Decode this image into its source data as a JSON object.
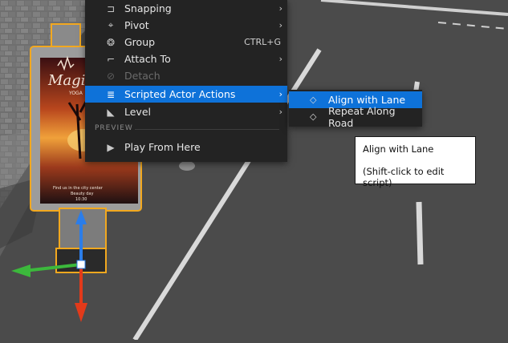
{
  "context_menu": {
    "items": [
      {
        "label": "Snapping",
        "icon": "snap-icon",
        "glyph": "⊐",
        "has_submenu": true
      },
      {
        "label": "Pivot",
        "icon": "pivot-icon",
        "glyph": "⌖",
        "has_submenu": true
      },
      {
        "label": "Group",
        "icon": "group-icon",
        "glyph": "❂",
        "shortcut": "CTRL+G"
      },
      {
        "label": "Attach To",
        "icon": "attach-icon",
        "glyph": "⌐",
        "has_submenu": true
      },
      {
        "label": "Detach",
        "icon": "detach-icon",
        "glyph": "⊘",
        "disabled": true
      },
      {
        "label": "Scripted Actor Actions",
        "icon": "script-icon",
        "glyph": "≣",
        "has_submenu": true,
        "active": true
      },
      {
        "label": "Level",
        "icon": "level-icon",
        "glyph": "◣",
        "has_submenu": true
      }
    ],
    "section_header": "PREVIEW",
    "preview_item": {
      "label": "Play From Here",
      "icon": "play-icon",
      "glyph": "▶"
    },
    "submenu_arrow": "›"
  },
  "submenu": {
    "items": [
      {
        "label": "Align with Lane",
        "icon": "action-icon",
        "glyph": "◇",
        "active": true
      },
      {
        "label": "Repeat Along Road",
        "icon": "action-icon",
        "glyph": "◇"
      }
    ]
  },
  "tooltip": {
    "title": "Align with Lane",
    "hint": "(Shift-click to edit script)"
  },
  "viewport": {
    "billboard_lines": [
      "Magi",
      "YOGA",
      "Find us in the city center",
      "Beauty day",
      "10:30"
    ],
    "colors": {
      "road": "#4b4b4b",
      "lane_line": "#d8d8d8",
      "selection": "#f2a81f",
      "gizmo_x": "#e23a1a",
      "gizmo_y": "#3cb83c",
      "gizmo_z": "#2b7de9"
    }
  }
}
